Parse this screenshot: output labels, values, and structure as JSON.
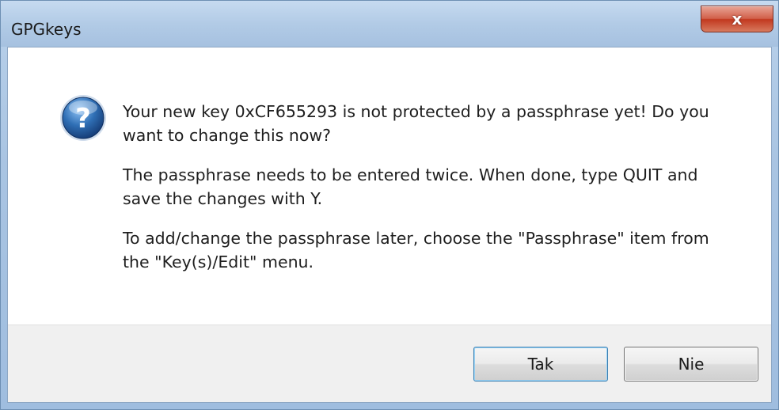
{
  "window": {
    "title": "GPGkeys",
    "close_label": "x"
  },
  "dialog": {
    "icon": "question-icon",
    "paragraphs": [
      "Your new key 0xCF655293 is not protected by a passphrase yet! Do you want to change this now?",
      "The passphrase needs to be entered twice. When done, type QUIT and save the changes with Y.",
      "To add/change the passphrase later, choose the \"Passphrase\" item from the \"Key(s)/Edit\" menu."
    ]
  },
  "buttons": {
    "yes_label": "Tak",
    "no_label": "Nie"
  },
  "colors": {
    "accent": "#2f6fb5",
    "close": "#c2381f"
  }
}
